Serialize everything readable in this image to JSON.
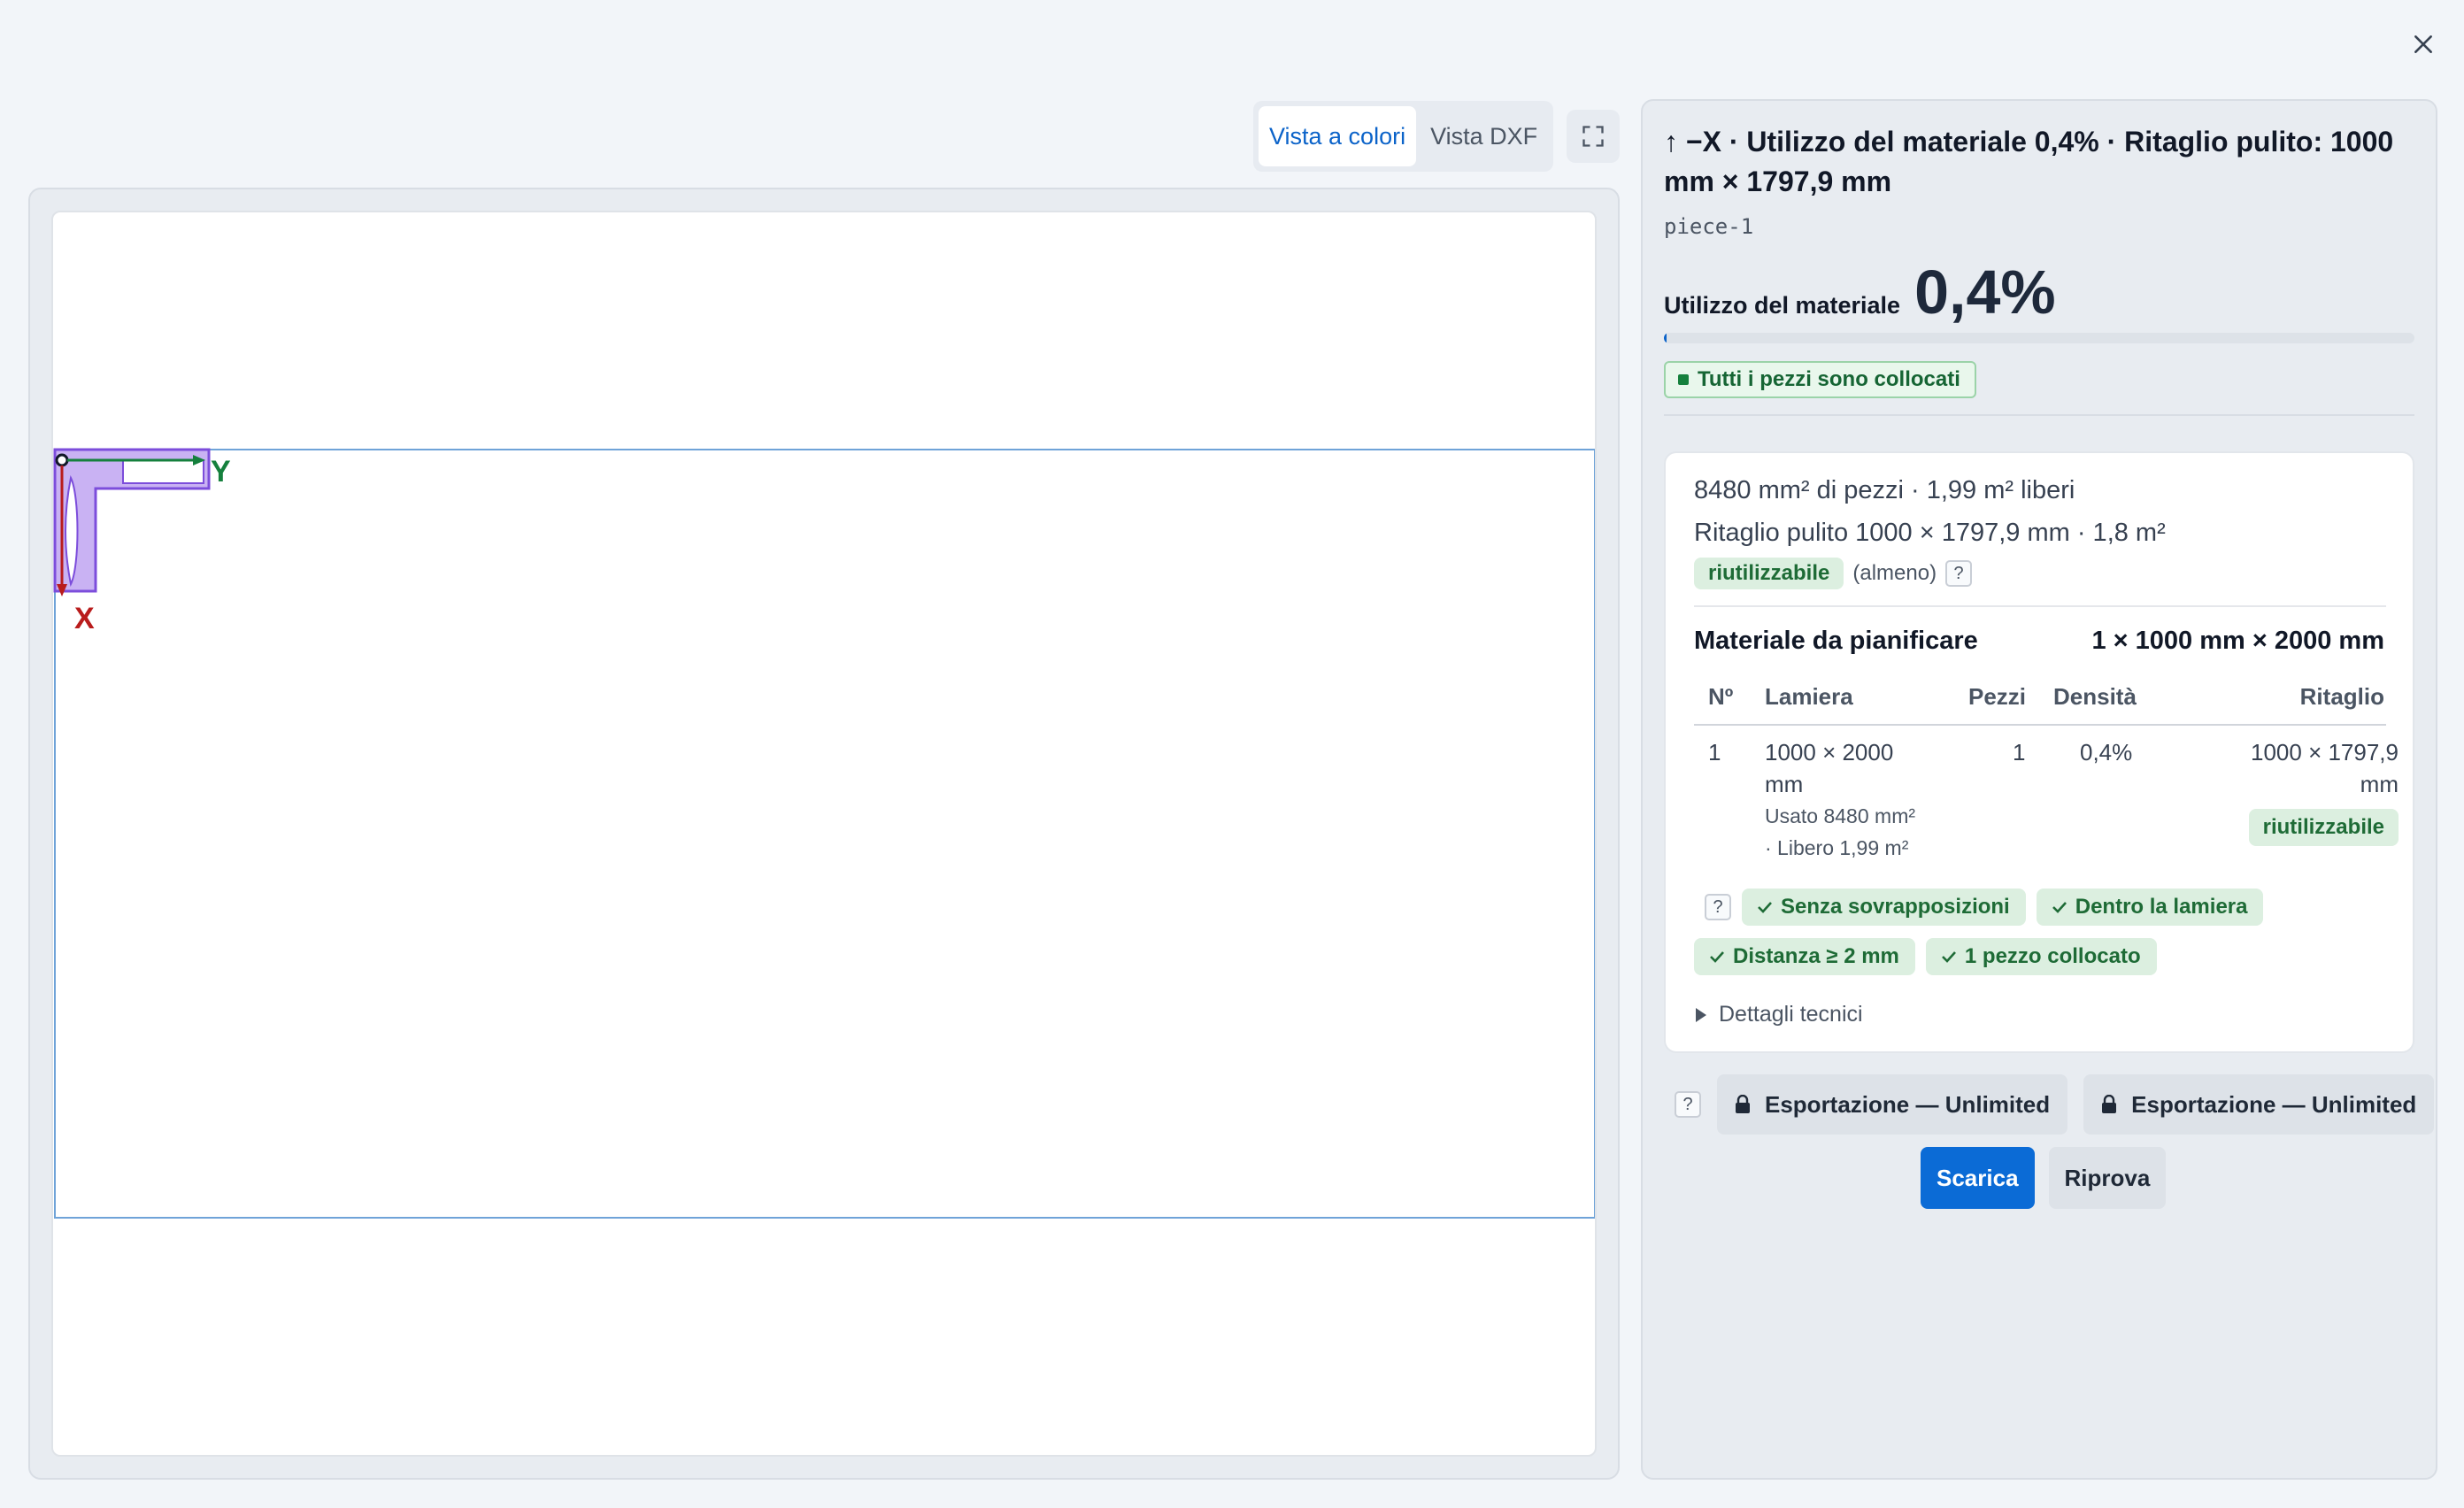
{
  "dialog": {
    "close_icon": "close-icon"
  },
  "view_toggle": {
    "tabs": [
      {
        "label": "Vista a colori",
        "active": true
      },
      {
        "label": "Vista DXF",
        "active": false
      }
    ],
    "fullscreen_icon": "fullscreen-icon"
  },
  "canvas": {
    "axis_x_label": "X",
    "axis_y_label": "Y",
    "colors": {
      "sheet": "#6fa3d8",
      "piece_fill": "#c9b2f3",
      "piece_stroke": "#7c4ddb",
      "axis_x": "#b91c1c",
      "axis_y": "#15803d"
    }
  },
  "summary": {
    "title": "↑ −X · Utilizzo del materiale 0,4% · Ritaglio pulito: 1000 mm × 1797,9 mm",
    "piece_id": "piece-1",
    "utilization_label": "Utilizzo del materiale",
    "utilization_value": "0,4%",
    "utilization_fraction": 0.004,
    "status_badge": "Tutti i pezzi sono collocati"
  },
  "details": {
    "area_line": "8480 mm² di pezzi · 1,99 m² liberi",
    "offcut_line": "Ritaglio pulito 1000 × 1797,9 mm · 1,8 m²",
    "reusable_chip": "riutilizzabile",
    "reusable_note": "(almeno)",
    "help": "?",
    "plan_label": "Materiale da pianificare",
    "plan_value": "1 × 1000 mm × 2000 mm",
    "table": {
      "headers": [
        "Nº",
        "Lamiera",
        "Pezzi",
        "Densità",
        "Ritaglio"
      ],
      "rows": [
        {
          "n": "1",
          "sheet_l1": "1000 × 2000",
          "sheet_l2": "mm",
          "used": "Usato 8480 mm²",
          "free": "· Libero 1,99 m²",
          "pieces": "1",
          "density": "0,4%",
          "offcut_l1": "1000 × 1797,9",
          "offcut_l2": "mm",
          "offcut_chip": "riutilizzabile"
        }
      ]
    },
    "checks": [
      "Senza sovrapposizioni",
      "Dentro la lamiera",
      "Distanza ≥ 2 mm",
      "1 pezzo collocato"
    ],
    "tech_details": "Dettagli tecnici"
  },
  "export": {
    "help": "?",
    "buttons": [
      "Esportazione — Unlimited",
      "Esportazione — Unlimited"
    ]
  },
  "actions": {
    "download": "Scarica",
    "retry": "Riprova"
  }
}
